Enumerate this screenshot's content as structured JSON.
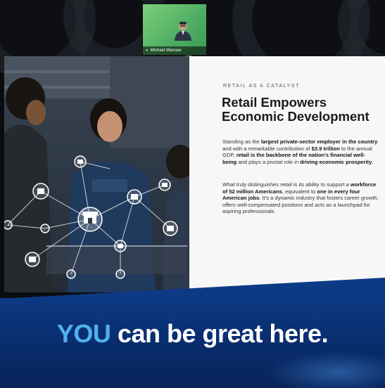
{
  "call": {
    "participant_name": "Michael Warsaw",
    "tile_icon": "microphone-icon"
  },
  "slide": {
    "kicker": "RETAIL AS A CATALYST",
    "headline_line1": "Retail Empowers",
    "headline_line2": "Economic Development",
    "p1": {
      "t1": "Standing as the ",
      "b1": "largest private-sector employer in the country",
      "t2": " and with a remarkable contribution of ",
      "b2": "$3.9 trillion",
      "t3": " to the annual GDP, ",
      "b3": "retail is the backbone of the nation's financial well-being",
      "t4": " and plays a pivotal role in ",
      "b4": "driving economic prosperity",
      "t5": "."
    },
    "p2": {
      "t1": "What truly distinguishes retail is its ability to support a ",
      "b1": "workforce of 52 million Americans",
      "t2": ", equivalent to ",
      "b2": "one in every four American jobs",
      "t3": ". It's a dynamic industry that fosters career growth, offers well-compensated positions and acts as a launchpad for aspiring professionals."
    },
    "network_icon": "store-icon"
  },
  "banner": {
    "highlight": "YOU",
    "rest": " can be great here."
  },
  "colors": {
    "banner": "#0a2f72",
    "highlight": "#4fb1ee",
    "tile": "#5cb86a"
  }
}
